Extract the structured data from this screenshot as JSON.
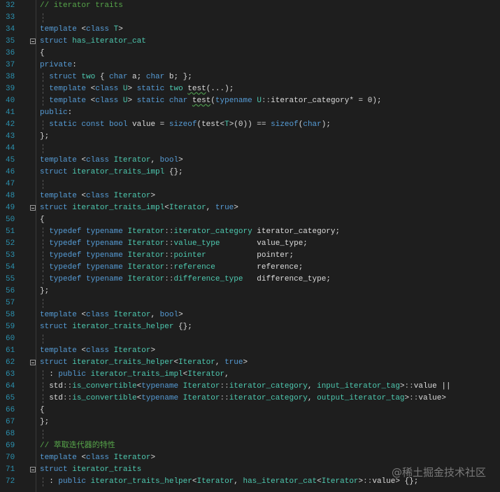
{
  "editor": {
    "colors": {
      "background": "#1e1e1e",
      "line_number": "#2b91af",
      "keyword": "#569cd6",
      "type": "#4ec9b0",
      "comment": "#57a64a",
      "text": "#dcdcdc"
    },
    "watermark": "@稀土掘金技术社区",
    "lines": [
      {
        "n": "32",
        "tokens": [
          [
            "c",
            "// iterator traits"
          ]
        ]
      },
      {
        "n": "33",
        "guide": true,
        "tokens": []
      },
      {
        "n": "34",
        "tokens": [
          [
            "k",
            "template"
          ],
          [
            "p",
            " <"
          ],
          [
            "k",
            "class"
          ],
          [
            "p",
            " "
          ],
          [
            "t",
            "T"
          ],
          [
            "p",
            ">"
          ]
        ]
      },
      {
        "n": "35",
        "fold": true,
        "tokens": [
          [
            "k",
            "struct"
          ],
          [
            "p",
            " "
          ],
          [
            "t",
            "has_iterator_cat"
          ]
        ]
      },
      {
        "n": "36",
        "tokens": [
          [
            "p",
            "{"
          ]
        ]
      },
      {
        "n": "37",
        "tokens": [
          [
            "k",
            "private"
          ],
          [
            "p",
            ":"
          ]
        ]
      },
      {
        "n": "38",
        "guide": true,
        "tokens": [
          [
            "p",
            "  "
          ],
          [
            "k",
            "struct"
          ],
          [
            "p",
            " "
          ],
          [
            "t",
            "two"
          ],
          [
            "p",
            " { "
          ],
          [
            "k",
            "char"
          ],
          [
            "p",
            " a; "
          ],
          [
            "k",
            "char"
          ],
          [
            "p",
            " b; };"
          ]
        ]
      },
      {
        "n": "39",
        "guide": true,
        "tokens": [
          [
            "p",
            "  "
          ],
          [
            "k",
            "template"
          ],
          [
            "p",
            " <"
          ],
          [
            "k",
            "class"
          ],
          [
            "p",
            " "
          ],
          [
            "t",
            "U"
          ],
          [
            "p",
            "> "
          ],
          [
            "k",
            "static"
          ],
          [
            "p",
            " "
          ],
          [
            "t",
            "two"
          ],
          [
            "p",
            " "
          ],
          [
            "sq",
            "test"
          ],
          [
            "p",
            "(...);"
          ]
        ]
      },
      {
        "n": "40",
        "guide": true,
        "tokens": [
          [
            "p",
            "  "
          ],
          [
            "k",
            "template"
          ],
          [
            "p",
            " <"
          ],
          [
            "k",
            "class"
          ],
          [
            "p",
            " "
          ],
          [
            "t",
            "U"
          ],
          [
            "p",
            "> "
          ],
          [
            "k",
            "static"
          ],
          [
            "p",
            " "
          ],
          [
            "k",
            "char"
          ],
          [
            "p",
            " "
          ],
          [
            "sq",
            "test"
          ],
          [
            "p",
            "("
          ],
          [
            "k",
            "typename"
          ],
          [
            "p",
            " "
          ],
          [
            "t",
            "U"
          ],
          [
            "o",
            "::"
          ],
          [
            "p",
            "iterator_category* = 0);"
          ]
        ]
      },
      {
        "n": "41",
        "tokens": [
          [
            "k",
            "public"
          ],
          [
            "p",
            ":"
          ]
        ]
      },
      {
        "n": "42",
        "guide": true,
        "tokens": [
          [
            "p",
            "  "
          ],
          [
            "k",
            "static"
          ],
          [
            "p",
            " "
          ],
          [
            "k",
            "const"
          ],
          [
            "p",
            " "
          ],
          [
            "k",
            "bool"
          ],
          [
            "p",
            " value = "
          ],
          [
            "k",
            "sizeof"
          ],
          [
            "p",
            "(test<"
          ],
          [
            "t",
            "T"
          ],
          [
            "p",
            ">(0)) == "
          ],
          [
            "k",
            "sizeof"
          ],
          [
            "p",
            "("
          ],
          [
            "k",
            "char"
          ],
          [
            "p",
            ");"
          ]
        ]
      },
      {
        "n": "43",
        "tokens": [
          [
            "p",
            "};"
          ]
        ]
      },
      {
        "n": "44",
        "guide": true,
        "tokens": []
      },
      {
        "n": "45",
        "tokens": [
          [
            "k",
            "template"
          ],
          [
            "p",
            " <"
          ],
          [
            "k",
            "class"
          ],
          [
            "p",
            " "
          ],
          [
            "t",
            "Iterator"
          ],
          [
            "p",
            ", "
          ],
          [
            "k",
            "bool"
          ],
          [
            "p",
            ">"
          ]
        ]
      },
      {
        "n": "46",
        "tokens": [
          [
            "k",
            "struct"
          ],
          [
            "p",
            " "
          ],
          [
            "t",
            "iterator_traits_impl"
          ],
          [
            "p",
            " {};"
          ]
        ]
      },
      {
        "n": "47",
        "guide": true,
        "tokens": []
      },
      {
        "n": "48",
        "tokens": [
          [
            "k",
            "template"
          ],
          [
            "p",
            " <"
          ],
          [
            "k",
            "class"
          ],
          [
            "p",
            " "
          ],
          [
            "t",
            "Iterator"
          ],
          [
            "p",
            ">"
          ]
        ]
      },
      {
        "n": "49",
        "fold": true,
        "tokens": [
          [
            "k",
            "struct"
          ],
          [
            "p",
            " "
          ],
          [
            "t",
            "iterator_traits_impl"
          ],
          [
            "p",
            "<"
          ],
          [
            "t",
            "Iterator"
          ],
          [
            "p",
            ", "
          ],
          [
            "k",
            "true"
          ],
          [
            "p",
            ">"
          ]
        ]
      },
      {
        "n": "50",
        "tokens": [
          [
            "p",
            "{"
          ]
        ]
      },
      {
        "n": "51",
        "guide": true,
        "tokens": [
          [
            "p",
            "  "
          ],
          [
            "k",
            "typedef"
          ],
          [
            "p",
            " "
          ],
          [
            "k",
            "typename"
          ],
          [
            "p",
            " "
          ],
          [
            "t",
            "Iterator"
          ],
          [
            "o",
            "::"
          ],
          [
            "t",
            "iterator_category"
          ],
          [
            "p",
            " iterator_category;"
          ]
        ]
      },
      {
        "n": "52",
        "guide": true,
        "tokens": [
          [
            "p",
            "  "
          ],
          [
            "k",
            "typedef"
          ],
          [
            "p",
            " "
          ],
          [
            "k",
            "typename"
          ],
          [
            "p",
            " "
          ],
          [
            "t",
            "Iterator"
          ],
          [
            "o",
            "::"
          ],
          [
            "t",
            "value_type"
          ],
          [
            "p",
            "        value_type;"
          ]
        ]
      },
      {
        "n": "53",
        "guide": true,
        "tokens": [
          [
            "p",
            "  "
          ],
          [
            "k",
            "typedef"
          ],
          [
            "p",
            " "
          ],
          [
            "k",
            "typename"
          ],
          [
            "p",
            " "
          ],
          [
            "t",
            "Iterator"
          ],
          [
            "o",
            "::"
          ],
          [
            "t",
            "pointer"
          ],
          [
            "p",
            "           pointer;"
          ]
        ]
      },
      {
        "n": "54",
        "guide": true,
        "tokens": [
          [
            "p",
            "  "
          ],
          [
            "k",
            "typedef"
          ],
          [
            "p",
            " "
          ],
          [
            "k",
            "typename"
          ],
          [
            "p",
            " "
          ],
          [
            "t",
            "Iterator"
          ],
          [
            "o",
            "::"
          ],
          [
            "t",
            "reference"
          ],
          [
            "p",
            "         reference;"
          ]
        ]
      },
      {
        "n": "55",
        "guide": true,
        "tokens": [
          [
            "p",
            "  "
          ],
          [
            "k",
            "typedef"
          ],
          [
            "p",
            " "
          ],
          [
            "k",
            "typename"
          ],
          [
            "p",
            " "
          ],
          [
            "t",
            "Iterator"
          ],
          [
            "o",
            "::"
          ],
          [
            "t",
            "difference_type"
          ],
          [
            "p",
            "   difference_type;"
          ]
        ]
      },
      {
        "n": "56",
        "tokens": [
          [
            "p",
            "};"
          ]
        ]
      },
      {
        "n": "57",
        "guide": true,
        "tokens": []
      },
      {
        "n": "58",
        "tokens": [
          [
            "k",
            "template"
          ],
          [
            "p",
            " <"
          ],
          [
            "k",
            "class"
          ],
          [
            "p",
            " "
          ],
          [
            "t",
            "Iterator"
          ],
          [
            "p",
            ", "
          ],
          [
            "k",
            "bool"
          ],
          [
            "p",
            ">"
          ]
        ]
      },
      {
        "n": "59",
        "tokens": [
          [
            "k",
            "struct"
          ],
          [
            "p",
            " "
          ],
          [
            "t",
            "iterator_traits_helper"
          ],
          [
            "p",
            " {};"
          ]
        ]
      },
      {
        "n": "60",
        "guide": true,
        "tokens": []
      },
      {
        "n": "61",
        "tokens": [
          [
            "k",
            "template"
          ],
          [
            "p",
            " <"
          ],
          [
            "k",
            "class"
          ],
          [
            "p",
            " "
          ],
          [
            "t",
            "Iterator"
          ],
          [
            "p",
            ">"
          ]
        ]
      },
      {
        "n": "62",
        "fold": true,
        "tokens": [
          [
            "k",
            "struct"
          ],
          [
            "p",
            " "
          ],
          [
            "t",
            "iterator_traits_helper"
          ],
          [
            "p",
            "<"
          ],
          [
            "t",
            "Iterator"
          ],
          [
            "p",
            ", "
          ],
          [
            "k",
            "true"
          ],
          [
            "p",
            ">"
          ]
        ]
      },
      {
        "n": "63",
        "guide": true,
        "tokens": [
          [
            "p",
            "  : "
          ],
          [
            "k",
            "public"
          ],
          [
            "p",
            " "
          ],
          [
            "t",
            "iterator_traits_impl"
          ],
          [
            "p",
            "<"
          ],
          [
            "t",
            "Iterator"
          ],
          [
            "p",
            ","
          ]
        ]
      },
      {
        "n": "64",
        "guide": true,
        "tokens": [
          [
            "p",
            "  std"
          ],
          [
            "o",
            "::"
          ],
          [
            "t",
            "is_convertible"
          ],
          [
            "p",
            "<"
          ],
          [
            "k",
            "typename"
          ],
          [
            "p",
            " "
          ],
          [
            "t",
            "Iterator"
          ],
          [
            "o",
            "::"
          ],
          [
            "t",
            "iterator_category"
          ],
          [
            "p",
            ", "
          ],
          [
            "t",
            "input_iterator_tag"
          ],
          [
            "p",
            ">"
          ],
          [
            "o",
            "::"
          ],
          [
            "p",
            "value ||"
          ]
        ]
      },
      {
        "n": "65",
        "guide": true,
        "tokens": [
          [
            "p",
            "  std"
          ],
          [
            "o",
            "::"
          ],
          [
            "t",
            "is_convertible"
          ],
          [
            "p",
            "<"
          ],
          [
            "k",
            "typename"
          ],
          [
            "p",
            " "
          ],
          [
            "t",
            "Iterator"
          ],
          [
            "o",
            "::"
          ],
          [
            "t",
            "iterator_category"
          ],
          [
            "p",
            ", "
          ],
          [
            "t",
            "output_iterator_tag"
          ],
          [
            "p",
            ">"
          ],
          [
            "o",
            "::"
          ],
          [
            "p",
            "value>"
          ]
        ]
      },
      {
        "n": "66",
        "tokens": [
          [
            "p",
            "{"
          ]
        ]
      },
      {
        "n": "67",
        "tokens": [
          [
            "p",
            "};"
          ]
        ]
      },
      {
        "n": "68",
        "guide": true,
        "tokens": []
      },
      {
        "n": "69",
        "tokens": [
          [
            "c",
            "// 萃取迭代器的特性"
          ]
        ]
      },
      {
        "n": "70",
        "tokens": [
          [
            "k",
            "template"
          ],
          [
            "p",
            " <"
          ],
          [
            "k",
            "class"
          ],
          [
            "p",
            " "
          ],
          [
            "t",
            "Iterator"
          ],
          [
            "p",
            ">"
          ]
        ]
      },
      {
        "n": "71",
        "fold": true,
        "tokens": [
          [
            "k",
            "struct"
          ],
          [
            "p",
            " "
          ],
          [
            "t",
            "iterator_traits"
          ]
        ]
      },
      {
        "n": "72",
        "guide": true,
        "tokens": [
          [
            "p",
            "  : "
          ],
          [
            "k",
            "public"
          ],
          [
            "p",
            " "
          ],
          [
            "t",
            "iterator_traits_helper"
          ],
          [
            "p",
            "<"
          ],
          [
            "t",
            "Iterator"
          ],
          [
            "p",
            ", "
          ],
          [
            "t",
            "has_iterator_cat"
          ],
          [
            "p",
            "<"
          ],
          [
            "t",
            "Iterator"
          ],
          [
            "p",
            ">"
          ],
          [
            "o",
            "::"
          ],
          [
            "p",
            "value> {};"
          ]
        ]
      }
    ]
  }
}
